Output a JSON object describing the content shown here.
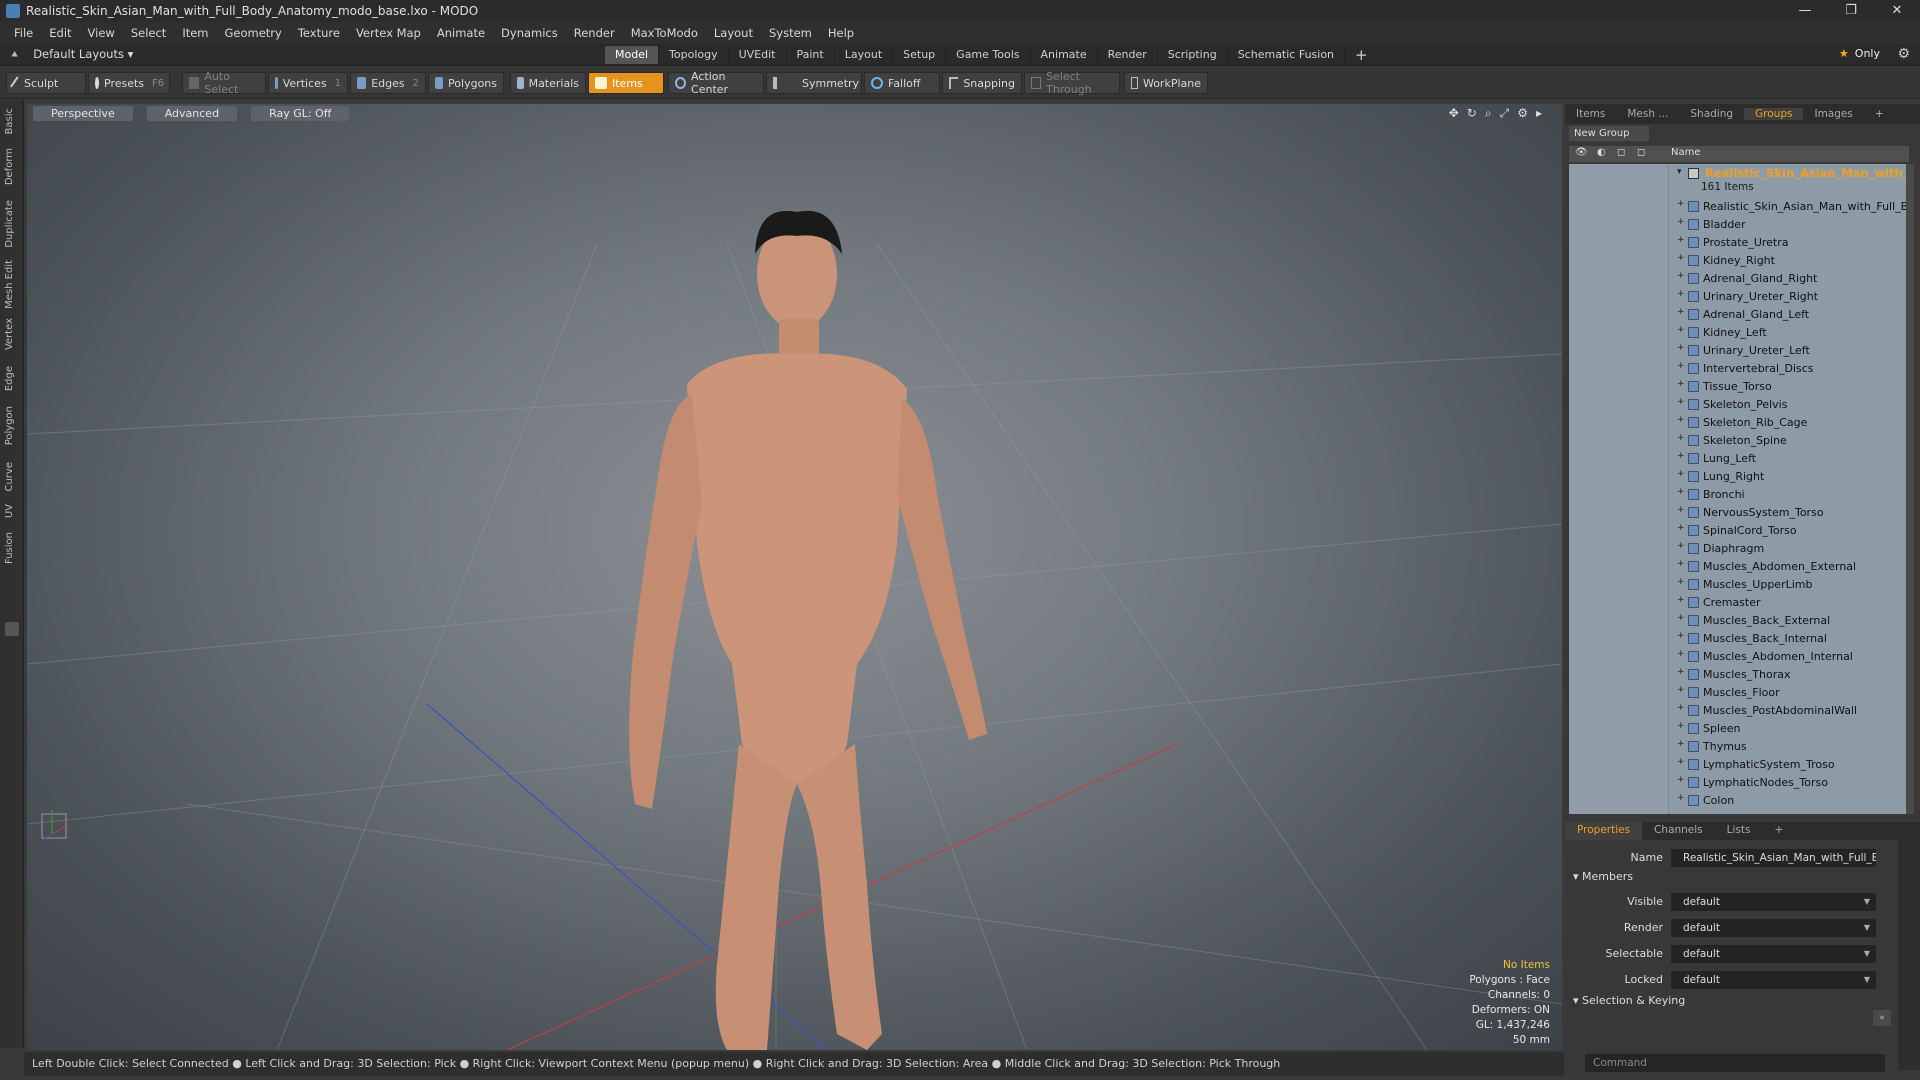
{
  "window": {
    "title": "Realistic_Skin_Asian_Man_with_Full_Body_Anatomy_modo_base.lxo - MODO",
    "controls": [
      "—",
      "❐",
      "✕"
    ]
  },
  "menu": [
    "File",
    "Edit",
    "View",
    "Select",
    "Item",
    "Geometry",
    "Texture",
    "Vertex Map",
    "Animate",
    "Dynamics",
    "Render",
    "MaxToModo",
    "Layout",
    "System",
    "Help"
  ],
  "layouts": {
    "label": "Default Layouts ▾"
  },
  "layout_tabs": [
    "Model",
    "Topology",
    "UVEdit",
    "Paint",
    "Layout",
    "Setup",
    "Game Tools",
    "Animate",
    "Render",
    "Scripting",
    "Schematic Fusion"
  ],
  "active_layout_tab": "Model",
  "only_label": "Only",
  "toolbar": {
    "sculpt": "Sculpt",
    "presets": "Presets",
    "presets_key": "F6",
    "auto_select": "Auto Select",
    "vertices": "Vertices",
    "vertices_key": "1",
    "edges": "Edges",
    "edges_key": "2",
    "polygons": "Polygons",
    "materials": "Materials",
    "items": "Items",
    "action_center": "Action Center",
    "symmetry": "Symmetry",
    "falloff": "Falloff",
    "snapping": "Snapping",
    "select_through": "Select Through",
    "workplane": "WorkPlane"
  },
  "left_rail": [
    "Basic",
    "Deform",
    "Duplicate",
    "Mesh Edit",
    "Vertex",
    "Edge",
    "Polygon",
    "Curve",
    "UV",
    "Fusion"
  ],
  "viewport": {
    "view_mode": "Perspective",
    "shading": "Advanced",
    "raygl": "Ray GL: Off",
    "info": {
      "no_items": "No Items",
      "polygons": "Polygons : Face",
      "channels": "Channels: 0",
      "deformers": "Deformers: ON",
      "gl": "GL: 1,437,246",
      "size": "50 mm"
    }
  },
  "status_bar": "Left Double Click: Select Connected ● Left Click and Drag: 3D Selection: Pick ● Right Click: Viewport Context Menu (popup menu) ● Right Click and Drag: 3D Selection: Area ● Middle Click and Drag: 3D Selection: Pick Through",
  "right_panel": {
    "tabs": [
      "Items",
      "Mesh ...",
      "Shading",
      "Groups",
      "Images",
      "+"
    ],
    "active_tab": "Groups",
    "new_group": "New Group",
    "column_name": "Name",
    "group_name": "Realistic_Skin_Asian_Man_with_F...",
    "group_count": "161 Items",
    "items": [
      "Realistic_Skin_Asian_Man_with_Full_B...",
      "Bladder",
      "Prostate_Uretra",
      "Kidney_Right",
      "Adrenal_Gland_Right",
      "Urinary_Ureter_Right",
      "Adrenal_Gland_Left",
      "Kidney_Left",
      "Urinary_Ureter_Left",
      "Intervertebral_Discs",
      "Tissue_Torso",
      "Skeleton_Pelvis",
      "Skeleton_Rib_Cage",
      "Skeleton_Spine",
      "Lung_Left",
      "Lung_Right",
      "Bronchi",
      "NervousSystem_Torso",
      "SpinalCord_Torso",
      "Diaphragm",
      "Muscles_Abdomen_External",
      "Muscles_UpperLimb",
      "Cremaster",
      "Muscles_Back_External",
      "Muscles_Back_Internal",
      "Muscles_Abdomen_Internal",
      "Muscles_Thorax",
      "Muscles_Floor",
      "Muscles_PostAbdominalWall",
      "Spleen",
      "Thymus",
      "LymphaticSystem_Troso",
      "LymphaticNodes_Torso",
      "Colon"
    ]
  },
  "properties": {
    "tabs": [
      "Properties",
      "Channels",
      "Lists",
      "+"
    ],
    "active_tab": "Properties",
    "name_label": "Name",
    "name_value": "Realistic_Skin_Asian_Man_with_Full_Bo",
    "members_section": "Members",
    "fields": [
      {
        "label": "Visible",
        "value": "default"
      },
      {
        "label": "Render",
        "value": "default"
      },
      {
        "label": "Selectable",
        "value": "default"
      },
      {
        "label": "Locked",
        "value": "default"
      }
    ],
    "selection_section": "Selection & Keying",
    "command_placeholder": "Command"
  },
  "colors": {
    "accent": "#e3931e",
    "list_bg": "#8d9ba6",
    "viewport_center": "#8b9095"
  }
}
